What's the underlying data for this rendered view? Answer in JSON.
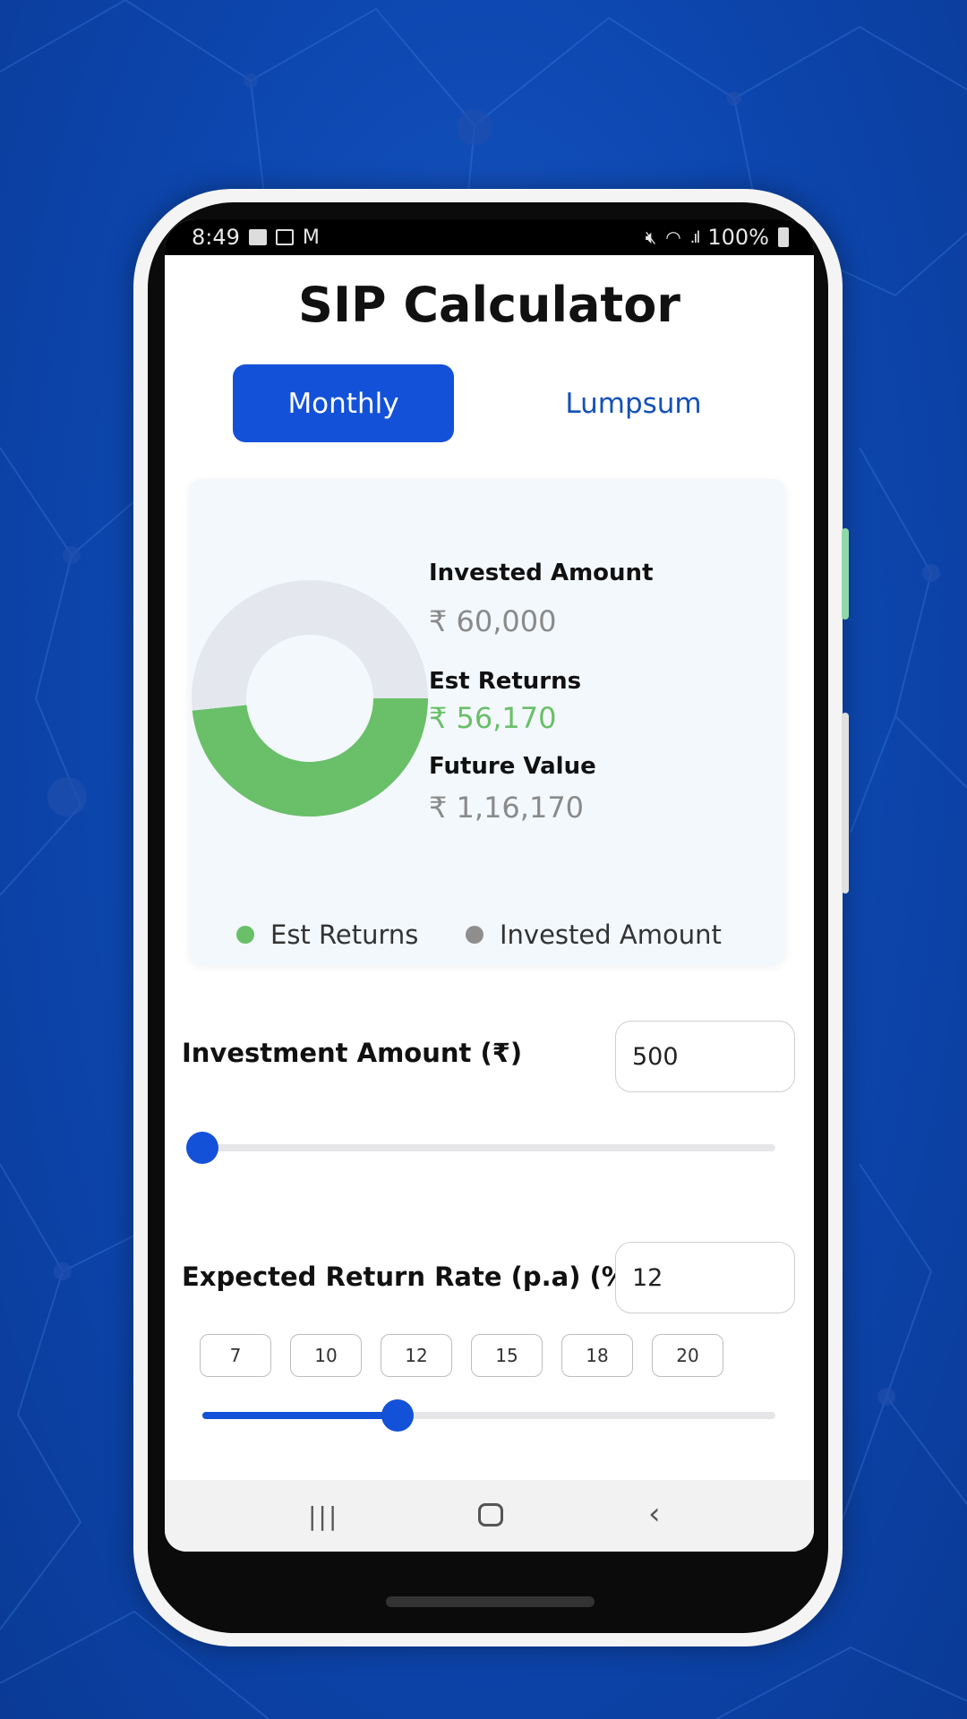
{
  "status_bar": {
    "time": "8:49",
    "battery": "100%",
    "left_icons": [
      "gallery-icon",
      "message-icon",
      "gmail-icon"
    ],
    "right_icons": [
      "mute-icon",
      "wifi-icon",
      "signal-icon",
      "battery-icon"
    ]
  },
  "header": {
    "title": "SIP Calculator"
  },
  "tabs": [
    {
      "label": "Monthly",
      "active": true
    },
    {
      "label": "Lumpsum",
      "active": false
    }
  ],
  "summary": {
    "invested_label": "Invested Amount",
    "invested_value": "₹ 60,000",
    "returns_label": "Est Returns",
    "returns_value": "₹ 56,170",
    "future_label": "Future Value",
    "future_value": "₹ 1,16,170"
  },
  "chart_data": {
    "type": "pie",
    "variant": "donut",
    "categories": [
      "Est Returns",
      "Invested Amount"
    ],
    "values": [
      56170,
      60000
    ],
    "colors": [
      "#6abf69",
      "#e4e8ee"
    ],
    "legend": [
      {
        "label": "Est Returns",
        "color": "#6abf69"
      },
      {
        "label": "Invested Amount",
        "color": "#8e8e8e"
      }
    ],
    "legend_placement": "bottom"
  },
  "investment": {
    "label": "Investment Amount (₹)",
    "value": "500",
    "slider_fraction": 0.0
  },
  "rate": {
    "label": "Expected Return Rate (p.a) (%)",
    "value": "12",
    "presets": [
      "7",
      "10",
      "12",
      "15",
      "18",
      "20"
    ],
    "slider_fraction": 0.34
  },
  "colors": {
    "accent": "#1351d8",
    "green": "#6abf69"
  },
  "navbar": {
    "icons": [
      "recent-apps-icon",
      "home-icon",
      "back-icon"
    ]
  }
}
